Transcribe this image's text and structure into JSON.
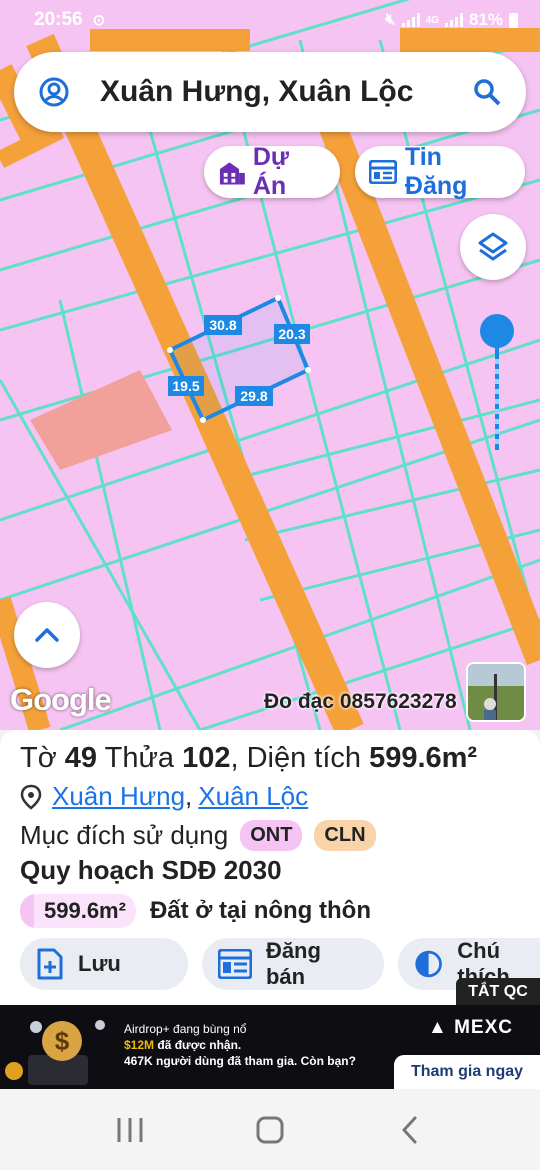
{
  "status_bar": {
    "time": "20:56",
    "network": "4G",
    "battery": "81%"
  },
  "search": {
    "text": "Xuân Hưng, Xuân Lộc"
  },
  "chips": {
    "du_an": "Dự Án",
    "tin_dang": "Tin Đăng"
  },
  "map": {
    "google_logo": "Google",
    "credit": "Đo đạc 0857623278",
    "parcel_edges": [
      "30.8",
      "20.3",
      "29.8",
      "19.5"
    ],
    "colors": {
      "land": "#f6c4f2",
      "road": "#f5a13a",
      "boundary": "#5fe0c8",
      "selection": "#1e88e5",
      "highlight": "#f2a19a"
    }
  },
  "parcel": {
    "to_label": "Tờ",
    "to_value": "49",
    "thua_label": "Thửa",
    "thua_value": "102",
    "dien_tich_label": ", Diện tích",
    "dien_tich_value": "599.6m²",
    "location_ward": "Xuân Hưng",
    "location_sep": ",",
    "location_district": "Xuân Lộc",
    "purpose_label": "Mục đích sử dụng",
    "tags": [
      "ONT",
      "CLN"
    ],
    "plan_title": "Quy hoạch SDĐ 2030",
    "plan_area": "599.6m²",
    "plan_desc": "Đất ở tại nông thôn"
  },
  "actions": {
    "save": "Lưu",
    "post": "Đăng bán",
    "legend": "Chú thích"
  },
  "ad": {
    "close_label": "TẮT QC",
    "line1": "Airdrop+ đang bùng nổ",
    "line2_highlight": "$12M",
    "line2_rest": " đã được nhận.",
    "line3": "467K người dùng đã tham gia. Còn bạn?",
    "brand": "MEXC",
    "cta": "Tham gia ngay"
  }
}
